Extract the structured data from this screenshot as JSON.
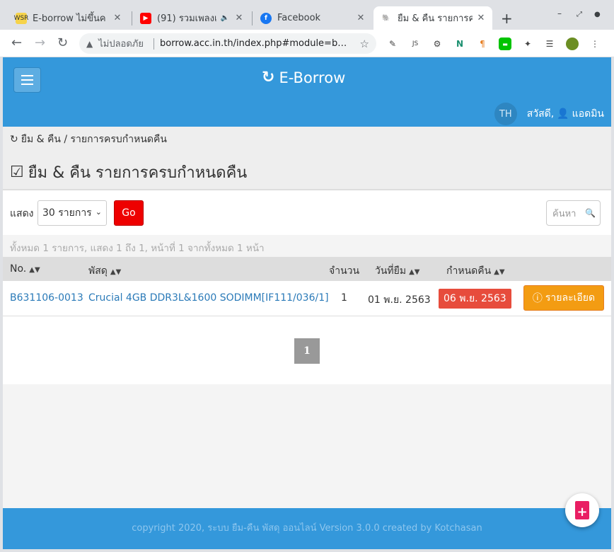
{
  "browser": {
    "tabs": [
      {
        "title": "E-borrow ไม่ขึ้นค",
        "favicon": "WSR",
        "favicon_bg": "#f6d34a"
      },
      {
        "title": "(91) รวมเพลงเ",
        "favicon": "▶",
        "favicon_bg": "#ff0000"
      },
      {
        "title": "Facebook",
        "favicon": "f",
        "favicon_bg": "#1877f2"
      },
      {
        "title": "ยืม & คืน รายการค",
        "favicon": "🐘",
        "favicon_bg": "#ffffff"
      }
    ],
    "new_tab": "+",
    "window_min": "–",
    "window_max": "⤢",
    "window_close": "●",
    "security_label": "ไม่ปลอดภัย",
    "url": "borrow.acc.in.th/index.php#module=b…"
  },
  "app": {
    "brand": "E-Borrow",
    "lang": "TH",
    "greeting": "สวัสดี,",
    "username": "แอดมิน"
  },
  "breadcrumb": "ยืม & คืน / รายการครบกำหนดคืน",
  "page_title": "ยืม & คืน รายการครบกำหนดคืน",
  "filter": {
    "show_label": "แสดง",
    "per_page": "30 รายการ",
    "go_label": "Go",
    "search_placeholder": "ค้นหา"
  },
  "summary": "ทั้งหมด 1 รายการ, แสดง 1 ถึง 1, หน้าที่ 1 จากทั้งหมด 1 หน้า",
  "table": {
    "columns": [
      "No.",
      "พัสดุ",
      "จำนวน",
      "วันที่ยืม",
      "กำหนดคืน"
    ],
    "rows": [
      {
        "no": "B631106-0013",
        "item": "Crucial 4GB DDR3L&1600 SODIMM[IF111/036/1]",
        "qty": "1",
        "borrow_date": "01 พ.ย. 2563",
        "due_date": "06 พ.ย. 2563",
        "action": "รายละเอียด"
      }
    ]
  },
  "pagination": {
    "current": "1"
  },
  "footer": "copyright 2020, ระบบ ยืม-คืน พัสดุ ออนไลน์ Version 3.0.0 created by Kotchasan",
  "colors": {
    "primary": "#3498db",
    "danger": "#e74c3c",
    "warning": "#f39c12"
  }
}
